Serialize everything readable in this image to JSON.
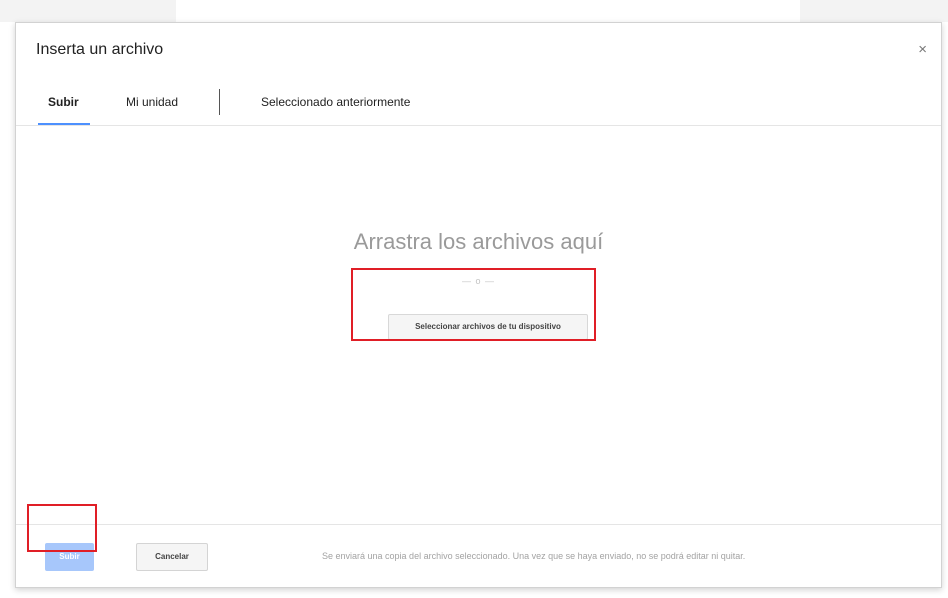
{
  "dialog": {
    "title": "Inserta un archivo",
    "close_label": "×"
  },
  "tabs": [
    {
      "label": "Subir",
      "active": true
    },
    {
      "label": "Mi unidad",
      "active": false
    },
    {
      "label": "Seleccionado anteriormente",
      "active": false
    }
  ],
  "dropzone": {
    "title": "Arrastra los archivos aquí",
    "divider": "— o —",
    "select_button": "Seleccionar archivos de tu dispositivo"
  },
  "footer": {
    "upload_label": "Subir",
    "cancel_label": "Cancelar",
    "note": "Se enviará una copia del archivo seleccionado. Una vez que se haya enviado, no se podrá editar ni quitar."
  },
  "colors": {
    "accent": "#4d90fe",
    "upload_disabled": "#a7c7fb",
    "highlight": "#e01e26"
  }
}
